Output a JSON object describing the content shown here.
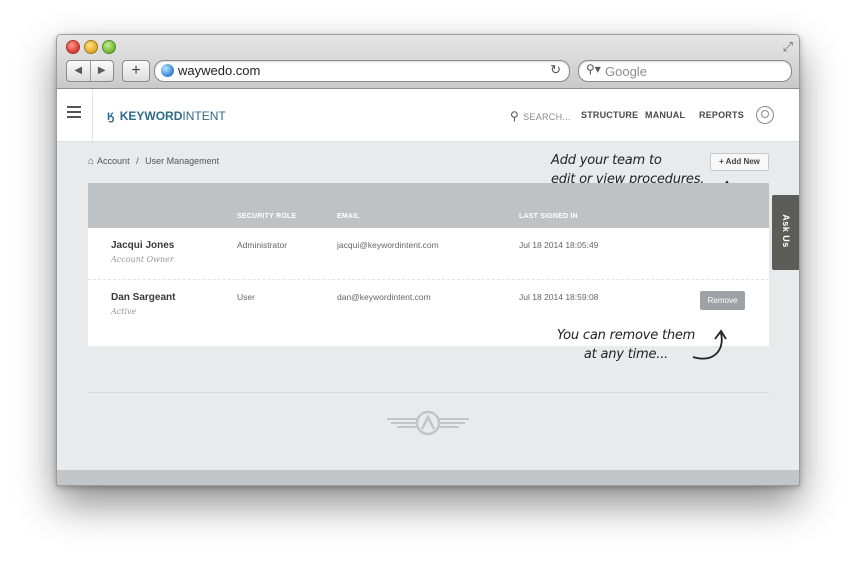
{
  "browser": {
    "url": "waywedo.com",
    "search_placeholder": "Google",
    "back_icon": "◀",
    "forward_icon": "▶",
    "new_tab": "+",
    "reload_icon": "↻",
    "fullscreen_icon": "⤢"
  },
  "app": {
    "logo_bold": "KEYWORD",
    "logo_light": "INTENT",
    "search_placeholder": "SEARCH...",
    "nav": [
      "STRUCTURE",
      "MANUAL",
      "REPORTS"
    ]
  },
  "breadcrumb": {
    "home": "Account",
    "separator": "/",
    "current": "User Management"
  },
  "add_button": "+ Add New",
  "annotations": {
    "add_line1": "Add your team to",
    "add_line2": "edit or view procedures.",
    "remove_line1": "You can remove them",
    "remove_line2": "at any time..."
  },
  "table": {
    "headers": [
      "SECURITY ROLE",
      "EMAIL",
      "LAST SIGNED IN"
    ],
    "rows": [
      {
        "name": "Jacqui Jones",
        "status": "Account Owner",
        "role": "Administrator",
        "email": "jacqui@keywordintent.com",
        "last_signed": "Jul 18 2014 18:05:49"
      },
      {
        "name": "Dan Sargeant",
        "status": "Active",
        "role": "User",
        "email": "dan@keywordintent.com",
        "last_signed": "Jul 18 2014 18:59:08",
        "action": "Remove"
      }
    ]
  },
  "side_tab": "Ask Us",
  "colors": {
    "brand": "#2e6a8b",
    "table_header": "#bec2c5",
    "page_bg": "#e8eaeb",
    "remove_button": "#9da2a6",
    "ask_tab": "#5c5c58"
  }
}
